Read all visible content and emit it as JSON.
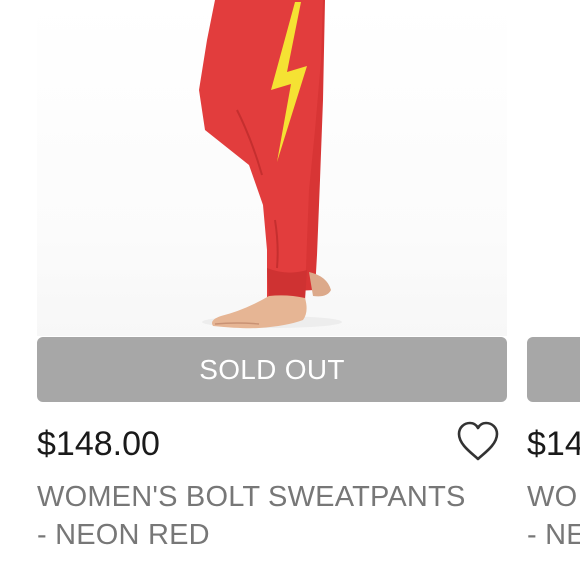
{
  "products": [
    {
      "status_label": "SOLD OUT",
      "price": "$148.00",
      "title_line1": "WOMEN'S BOLT SWEATPANTS",
      "title_line2": "- NEON RED",
      "wishlist_icon": "heart-outline-icon",
      "image": {
        "subject": "red sweatpants with yellow lightning bolt",
        "pant_color": "#e23d3d",
        "bolt_color": "#f5e233",
        "skin_color": "#e6b594"
      }
    },
    {
      "status_label": "",
      "price": "$14",
      "title_line1": "WO",
      "title_line2": "- NE"
    }
  ],
  "colors": {
    "sold_out_bg": "#a7a7a7",
    "price_text": "#1a1a1a",
    "title_text": "#777777"
  }
}
